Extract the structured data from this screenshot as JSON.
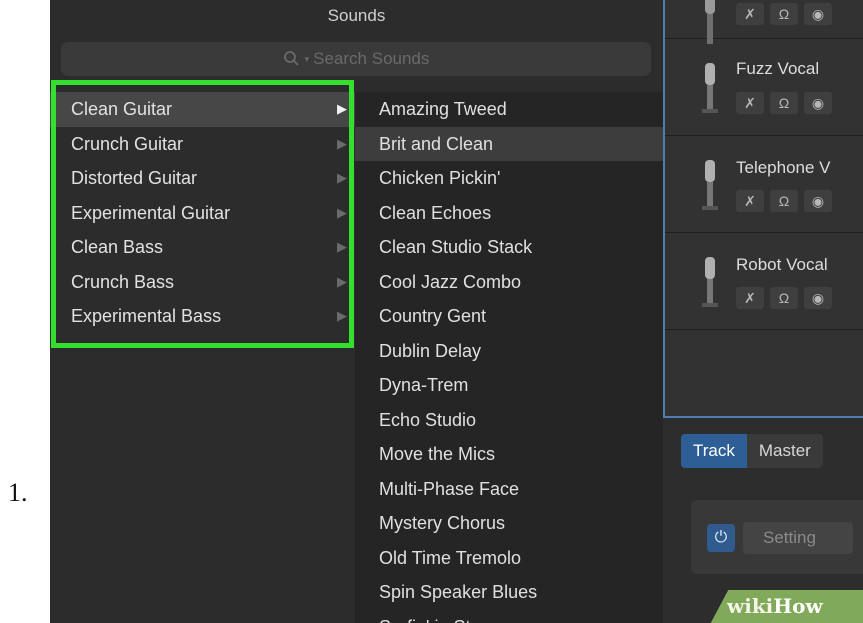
{
  "step_number": "1.",
  "sounds_panel": {
    "title": "Sounds",
    "search": {
      "placeholder": "Search Sounds"
    },
    "categories": [
      {
        "label": "Clean Guitar",
        "selected": true
      },
      {
        "label": "Crunch Guitar"
      },
      {
        "label": "Distorted Guitar"
      },
      {
        "label": "Experimental Guitar"
      },
      {
        "label": "Clean Bass"
      },
      {
        "label": "Crunch Bass"
      },
      {
        "label": "Experimental Bass"
      }
    ],
    "sounds": [
      "Amazing Tweed",
      "Brit and Clean",
      "Chicken Pickin'",
      "Clean Echoes",
      "Clean Studio Stack",
      "Cool Jazz Combo",
      "Country Gent",
      "Dublin Delay",
      "Dyna-Trem",
      "Echo Studio",
      "Move the Mics",
      "Multi-Phase Face",
      "Mystery Chorus",
      "Old Time Tremolo",
      "Spin Speaker Blues",
      "Surfin' in Stereo"
    ],
    "selected_sound": "Brit and Clean"
  },
  "tracks": [
    {
      "name": ""
    },
    {
      "name": "Fuzz Vocal"
    },
    {
      "name": "Telephone V"
    },
    {
      "name": "Robot Vocal"
    }
  ],
  "inspector": {
    "tabs": [
      {
        "label": "Track",
        "active": true
      },
      {
        "label": "Master"
      }
    ],
    "setting_label": "Setting"
  },
  "watermark": {
    "part1": "wiki",
    "part2": "How"
  },
  "colors": {
    "highlight": "#33e02d",
    "accent": "#2d5f96",
    "panel_bg": "#2c2c2c"
  }
}
